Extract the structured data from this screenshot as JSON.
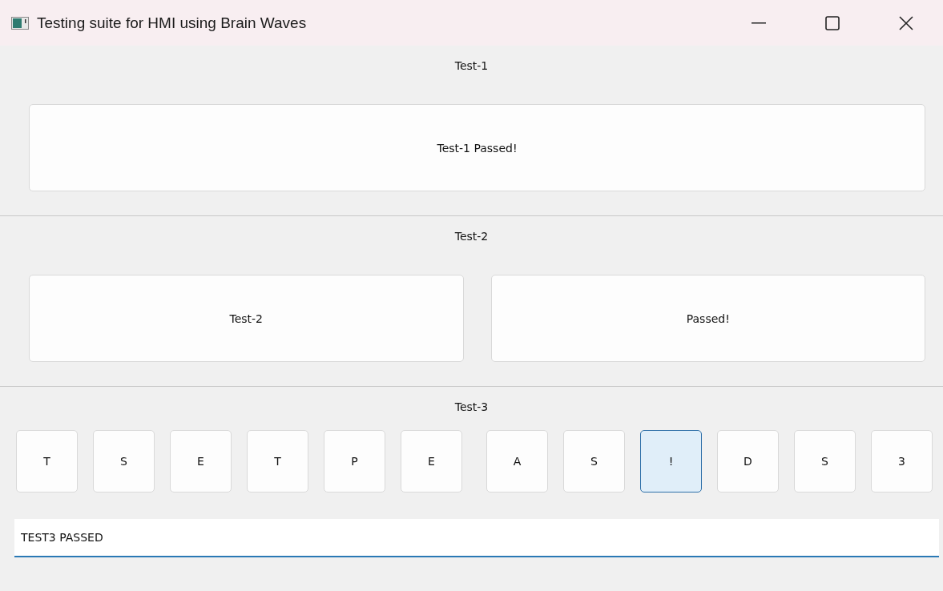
{
  "window": {
    "title": "Testing suite for HMI using Brain Waves"
  },
  "sections": [
    {
      "kind": "buttons",
      "heading": "Test-1",
      "buttons": [
        "Test-1 Passed!"
      ]
    },
    {
      "kind": "buttons",
      "heading": "Test-2",
      "buttons": [
        "Test-2",
        "Passed!"
      ]
    },
    {
      "kind": "keys",
      "heading": "Test-3",
      "key_groups": [
        [
          {
            "label": "T",
            "selected": false
          },
          {
            "label": "S",
            "selected": false
          },
          {
            "label": "E",
            "selected": false
          },
          {
            "label": "T",
            "selected": false
          },
          {
            "label": "P",
            "selected": false
          },
          {
            "label": "E",
            "selected": false
          }
        ],
        [
          {
            "label": "A",
            "selected": false
          },
          {
            "label": "S",
            "selected": false
          },
          {
            "label": "!",
            "selected": true
          },
          {
            "label": "D",
            "selected": false
          },
          {
            "label": "S",
            "selected": false
          },
          {
            "label": "3",
            "selected": false
          }
        ]
      ],
      "input": {
        "value": "TEST3 PASSED"
      }
    }
  ]
}
